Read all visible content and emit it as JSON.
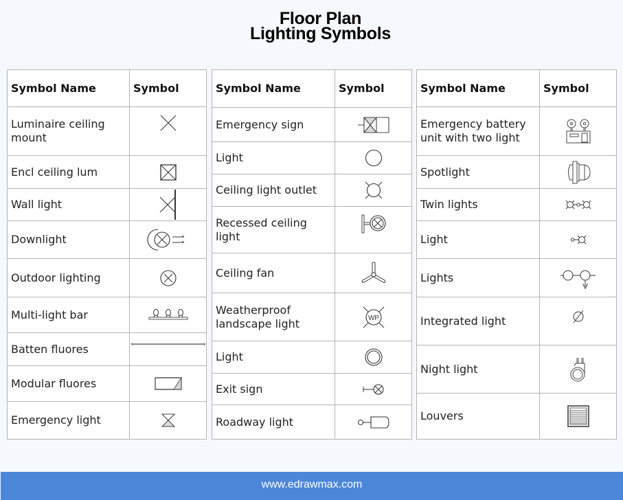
{
  "title": {
    "line1": "Floor Plan",
    "line2": "Lighting Symbols"
  },
  "headers": {
    "name": "Symbol Name",
    "symbol": "Symbol"
  },
  "tables": [
    {
      "rows": [
        {
          "name": "Luminaire ceiling mount",
          "icon": "luminaire-ceiling-mount-icon"
        },
        {
          "name": "Encl ceiling lum",
          "icon": "encl-ceiling-lum-icon"
        },
        {
          "name": "Wall light",
          "icon": "wall-light-icon"
        },
        {
          "name": "Downlight",
          "icon": "downlight-icon"
        },
        {
          "name": "Outdoor lighting",
          "icon": "outdoor-lighting-icon"
        },
        {
          "name": "Multi-light bar",
          "icon": "multi-light-bar-icon"
        },
        {
          "name": "Batten fluores",
          "icon": "batten-fluores-icon"
        },
        {
          "name": "Modular fluores",
          "icon": "modular-fluores-icon"
        },
        {
          "name": "Emergency light",
          "icon": "emergency-light-icon"
        }
      ]
    },
    {
      "rows": [
        {
          "name": "Emergency sign",
          "icon": "emergency-sign-icon"
        },
        {
          "name": "Light",
          "icon": "light-circle-icon"
        },
        {
          "name": "Ceiling light outlet",
          "icon": "ceiling-light-outlet-icon"
        },
        {
          "name": "Recessed ceiling light",
          "icon": "recessed-ceiling-light-icon"
        },
        {
          "name": "Ceiling fan",
          "icon": "ceiling-fan-icon"
        },
        {
          "name": "Weatherproof landscape light",
          "icon": "weatherproof-landscape-light-icon",
          "label": "WP"
        },
        {
          "name": "Light",
          "icon": "light-double-circle-icon"
        },
        {
          "name": "Exit sign",
          "icon": "exit-sign-icon"
        },
        {
          "name": "Roadway light",
          "icon": "roadway-light-icon"
        }
      ]
    },
    {
      "rows": [
        {
          "name": "Emergency battery unit with two light",
          "icon": "emergency-battery-unit-icon"
        },
        {
          "name": "Spotlight",
          "icon": "spotlight-icon"
        },
        {
          "name": "Twin lights",
          "icon": "twin-lights-icon"
        },
        {
          "name": "Light",
          "icon": "light-outlet-icon"
        },
        {
          "name": "Lights",
          "icon": "lights-chain-icon"
        },
        {
          "name": "Integrated light",
          "icon": "integrated-light-icon"
        },
        {
          "name": "Night light",
          "icon": "night-light-icon"
        },
        {
          "name": "Louvers",
          "icon": "louvers-icon"
        }
      ]
    }
  ],
  "colors": {
    "background": "#f5f8fd",
    "footer": "#4c86d9",
    "border": "#b4b4b4"
  },
  "footer": {
    "url": "www.edrawmax.com"
  }
}
